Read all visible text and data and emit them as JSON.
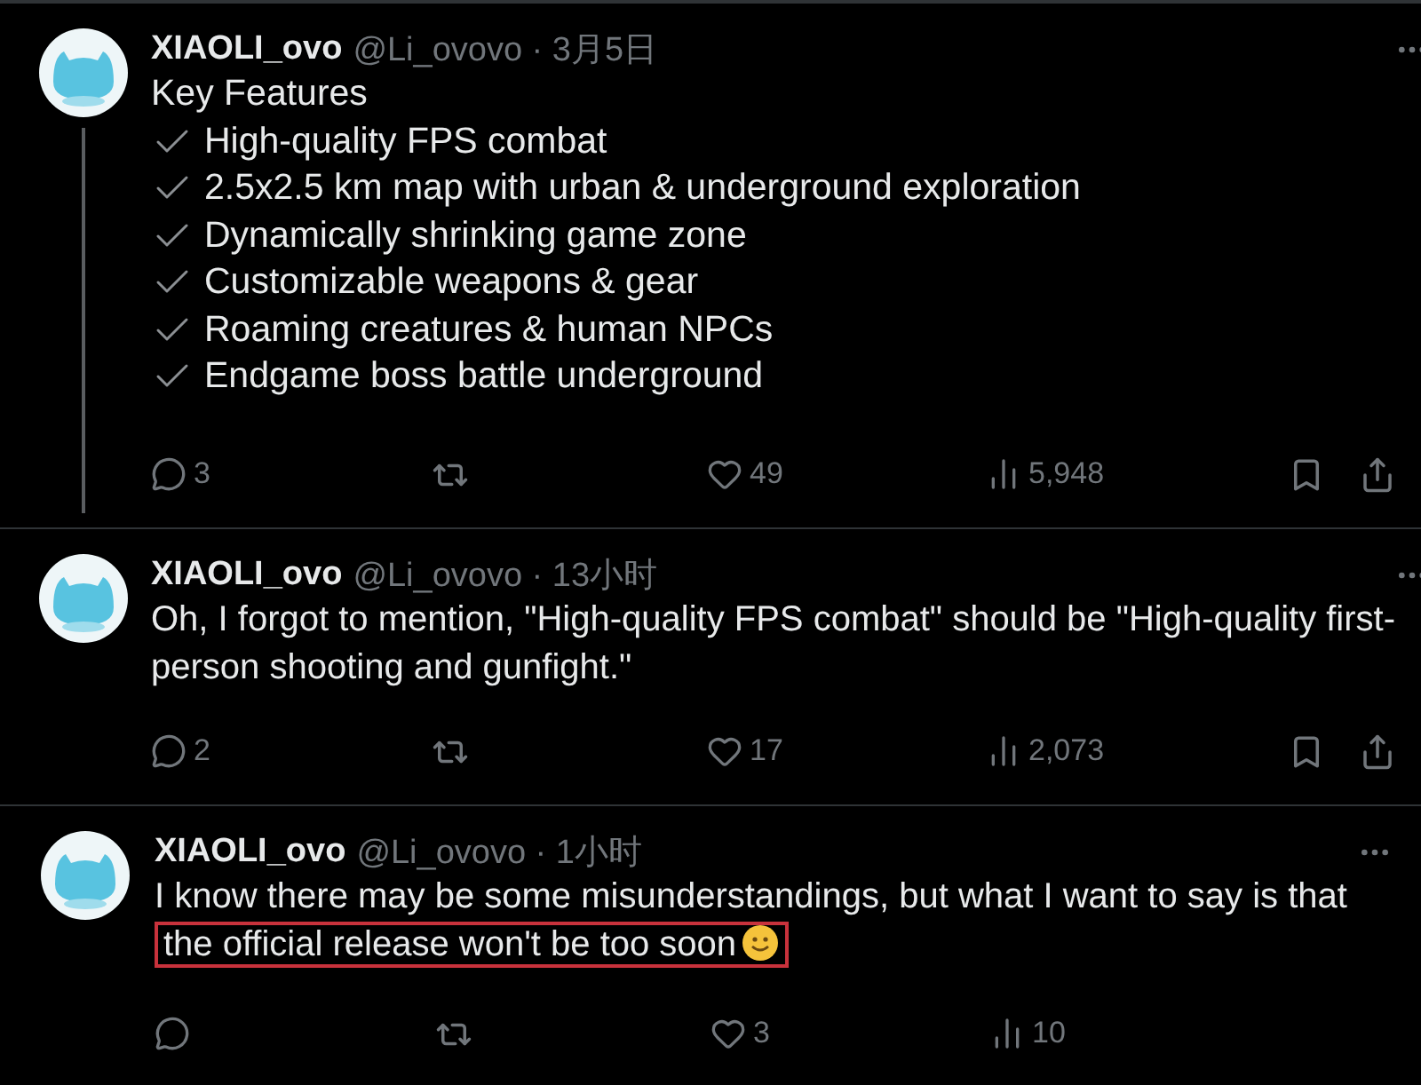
{
  "tweets": [
    {
      "name": "XIAOLI_ovo",
      "handle": "@Li_ovovo",
      "separator": "·",
      "time": "3月5日",
      "thread_line": true,
      "lines": [
        {
          "kind": "plain",
          "text": "Key Features"
        },
        {
          "kind": "check",
          "text": "High-quality FPS combat"
        },
        {
          "kind": "check",
          "text": "2.5x2.5 km map with urban & underground exploration"
        },
        {
          "kind": "check",
          "text": "Dynamically shrinking game zone"
        },
        {
          "kind": "check",
          "text": "Customizable weapons & gear"
        },
        {
          "kind": "check",
          "text": "Roaming creatures & human NPCs"
        },
        {
          "kind": "check",
          "text": "Endgame boss battle underground"
        }
      ],
      "actions": [
        {
          "kind": "reply",
          "count": "3"
        },
        {
          "kind": "repost"
        },
        {
          "kind": "like",
          "count": "49"
        },
        {
          "kind": "views",
          "count": "5,948"
        },
        {
          "kind": "bookmark"
        },
        {
          "kind": "share"
        }
      ]
    },
    {
      "name": "XIAOLI_ovo",
      "handle": "@Li_ovovo",
      "separator": "·",
      "time": "13小时",
      "thread_line": false,
      "segments": [
        {
          "text": "Oh, I forgot to mention, \"High-quality FPS combat\" should be \"High-quality first-person shooting and gunfight.\"",
          "highlighted": false
        }
      ],
      "actions": [
        {
          "kind": "reply",
          "count": "2"
        },
        {
          "kind": "repost"
        },
        {
          "kind": "like",
          "count": "17"
        },
        {
          "kind": "views",
          "count": "2,073"
        },
        {
          "kind": "bookmark"
        },
        {
          "kind": "share"
        }
      ]
    },
    {
      "name": "XIAOLI_ovo",
      "handle": "@Li_ovovo",
      "separator": "·",
      "time": "1小时",
      "thread_line": false,
      "segments": [
        {
          "text": "I know there may be some misunderstandings, but what I want to say is that ",
          "highlighted": false
        },
        {
          "text": "the official release won't be too soon",
          "highlighted": true,
          "smiley": true
        }
      ],
      "actions": [
        {
          "kind": "reply"
        },
        {
          "kind": "repost"
        },
        {
          "kind": "like",
          "count": "3"
        },
        {
          "kind": "views",
          "count": "10"
        }
      ]
    }
  ]
}
